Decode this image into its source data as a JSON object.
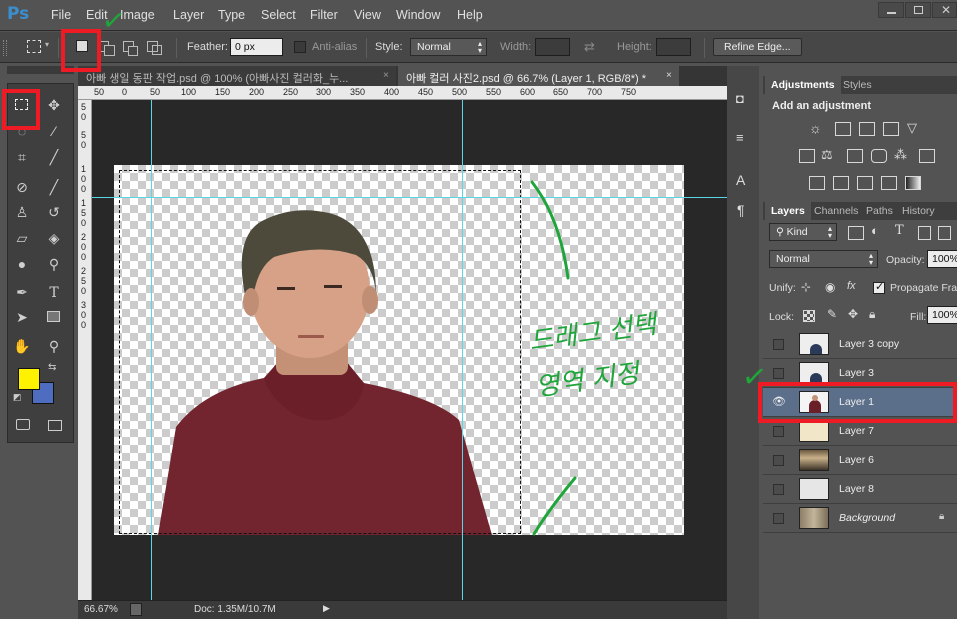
{
  "app": {
    "logo": "Ps"
  },
  "menu": [
    "File",
    "Edit",
    "Image",
    "Layer",
    "Type",
    "Select",
    "Filter",
    "View",
    "Window",
    "Help"
  ],
  "options": {
    "feather_label": "Feather:",
    "feather_value": "0 px",
    "antialias_label": "Anti-alias",
    "style_label": "Style:",
    "style_value": "Normal",
    "width_label": "Width:",
    "height_label": "Height:",
    "refine_edge": "Refine Edge..."
  },
  "doc_tabs": [
    {
      "label": "아빠 생일 동판 작업.psd @ 100% (아빠사진 컬러화_누..."
    },
    {
      "label": "아빠 컬러 사진2.psd @ 66.7% (Layer 1, RGB/8*) *"
    }
  ],
  "ruler_top": [
    "50",
    "0",
    "50",
    "100",
    "150",
    "200",
    "250",
    "300",
    "350",
    "400",
    "450",
    "500",
    "550",
    "600",
    "650",
    "700",
    "750"
  ],
  "ruler_left": [
    "5",
    "0",
    "5",
    "0",
    "1",
    "0",
    "0",
    "1",
    "5",
    "0",
    "2",
    "0",
    "0",
    "2",
    "5",
    "0",
    "3",
    "0",
    "0"
  ],
  "status": {
    "zoom": "66.67%",
    "doc": "Doc: 1.35M/10.7M"
  },
  "adjustments": {
    "tab_active": "Adjustments",
    "tab_other": "Styles",
    "heading": "Add an adjustment"
  },
  "layers_panel": {
    "tabs": [
      "Layers",
      "Channels",
      "Paths",
      "History"
    ],
    "kind": "Kind",
    "blend_mode": "Normal",
    "opacity_label": "Opacity:",
    "opacity_value": "100%",
    "unify_label": "Unify:",
    "propagate_label": "Propagate Fram",
    "lock_label": "Lock:",
    "fill_label": "Fill:",
    "fill_value": "100%",
    "layers": [
      {
        "name": "Layer 3 copy",
        "visible": false,
        "selected": false
      },
      {
        "name": "Layer 3",
        "visible": false,
        "selected": false
      },
      {
        "name": "Layer 1",
        "visible": true,
        "selected": true
      },
      {
        "name": "Layer 7",
        "visible": false,
        "selected": false
      },
      {
        "name": "Layer 6",
        "visible": false,
        "selected": false
      },
      {
        "name": "Layer 8",
        "visible": false,
        "selected": false
      },
      {
        "name": "Background",
        "visible": false,
        "selected": false
      }
    ]
  },
  "annotation": {
    "handwritten_text": "드래그 선택영역 지정",
    "colors": {
      "annotation": "#1fa53a",
      "highlight": "#ee1b24",
      "guide": "#5ad7e6",
      "foreground": "#fff200",
      "background": "#4f6dc0"
    }
  }
}
